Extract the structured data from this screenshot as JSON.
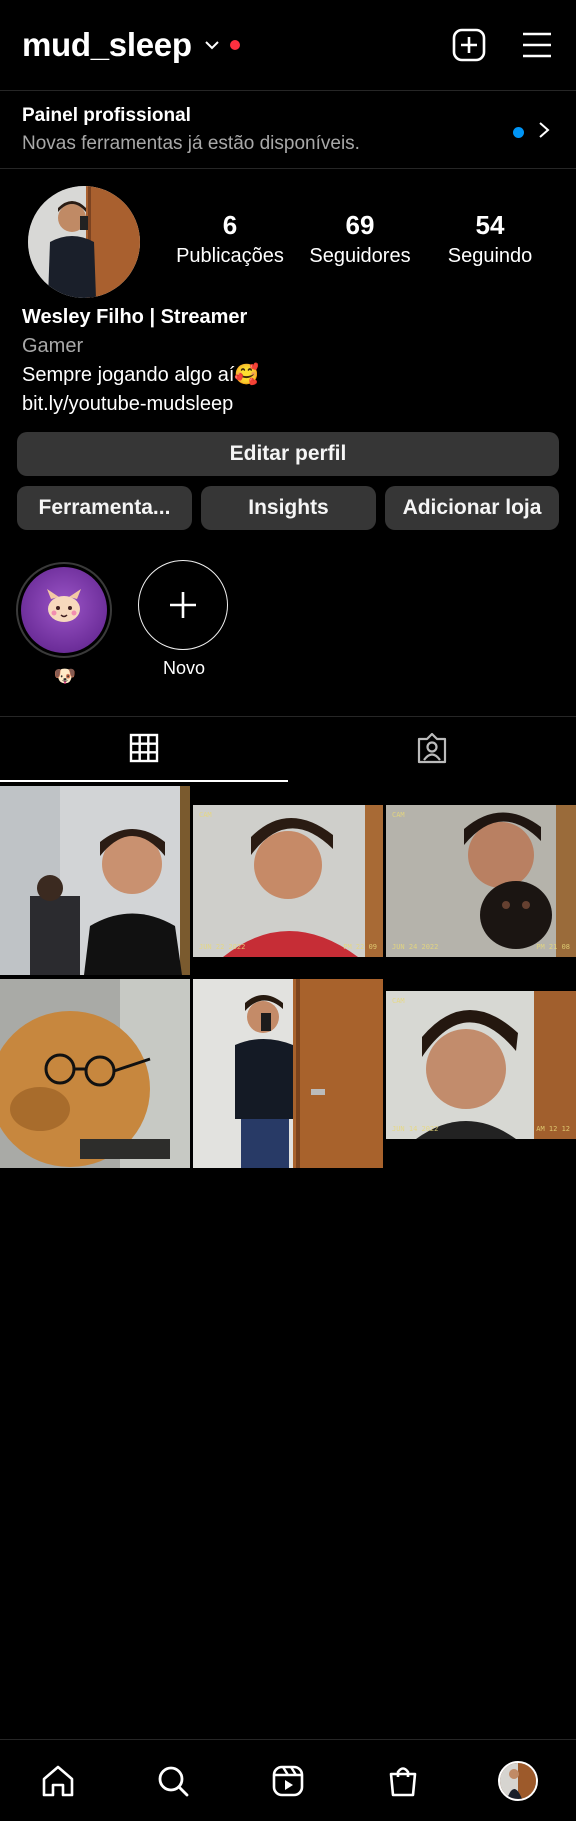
{
  "header": {
    "username": "mud_sleep",
    "icons": [
      "chevron-down-icon",
      "notification-dot",
      "new-post-icon",
      "menu-icon"
    ],
    "accent_dot_color": "#ff3040"
  },
  "pro_panel": {
    "title": "Painel profissional",
    "subtitle": "Novas ferramentas já estão disponíveis."
  },
  "profile": {
    "stats": [
      {
        "value": "6",
        "label": "Publicações"
      },
      {
        "value": "69",
        "label": "Seguidores"
      },
      {
        "value": "54",
        "label": "Seguindo"
      }
    ],
    "name": "Wesley Filho | Streamer",
    "category": "Gamer",
    "bio": "Sempre jogando algo aí🥰",
    "link": "bit.ly/youtube-mudsleep"
  },
  "buttons": {
    "edit": "Editar perfil",
    "tools": "Ferramenta...",
    "insights": "Insights",
    "shop": "Adicionar loja"
  },
  "highlights": [
    {
      "label": "🐶",
      "icon": "cat-sticker-icon"
    },
    {
      "label": "Novo",
      "icon": "plus-icon"
    }
  ],
  "tabs": [
    {
      "name": "posts-grid",
      "icon": "grid-icon",
      "active": true
    },
    {
      "name": "tagged",
      "icon": "tagged-person-icon",
      "active": false
    }
  ],
  "posts": [
    {
      "stamp_left": "",
      "stamp_right": ""
    },
    {
      "stamp_left": "JUN 22 2022",
      "stamp_right": "PM 22 09"
    },
    {
      "stamp_left": "JUN 24 2022",
      "stamp_right": "PM 21 08"
    },
    {
      "stamp_left": "",
      "stamp_right": ""
    },
    {
      "stamp_left": "",
      "stamp_right": ""
    },
    {
      "stamp_left": "JUN 14 2022",
      "stamp_right": "AM 12 12"
    }
  ],
  "camera_label": "CAM",
  "bottom_nav": [
    "home-icon",
    "search-icon",
    "reels-icon",
    "shop-icon",
    "profile-avatar"
  ]
}
